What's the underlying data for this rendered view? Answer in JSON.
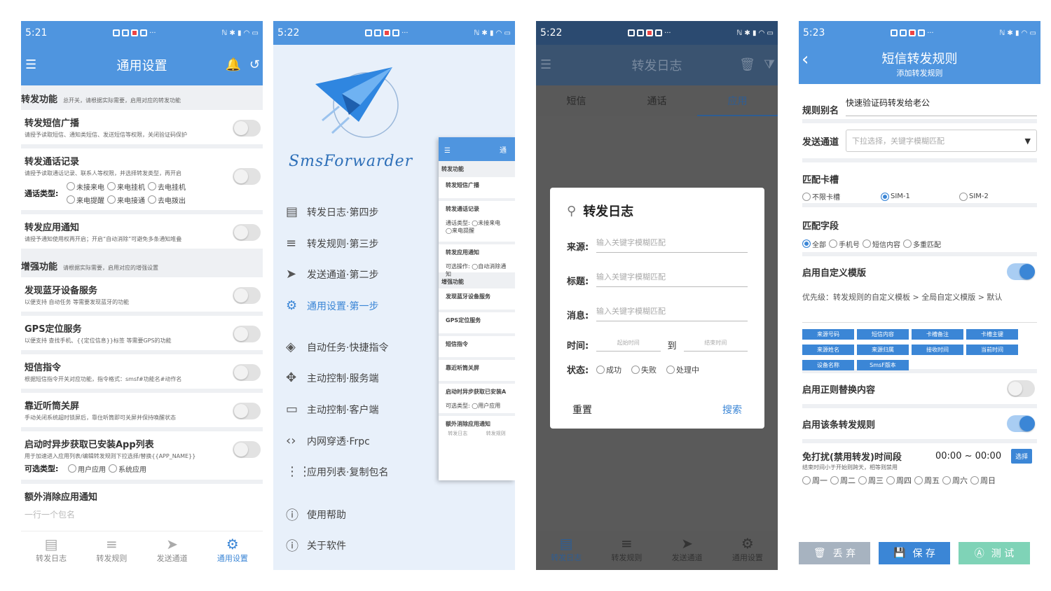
{
  "p1": {
    "time": "5:21",
    "title": "通用设置",
    "sec1": {
      "t": "转发功能",
      "d": "总开关，请根据实际需要，启用对应的转发功能"
    },
    "sms": {
      "t": "转发短信广播",
      "d": "请授予读取短信、通知类短信、发送短信等权限，关闭验证码保护"
    },
    "call": {
      "t": "转发通话记录",
      "d": "请授予读取通话记录、联系人等权限，并选择转发类型，再开启",
      "type_label": "通话类型:",
      "opts": [
        "未接来电",
        "来电挂机",
        "去电挂机",
        "来电提醒",
        "来电接通",
        "去电拨出"
      ]
    },
    "app": {
      "t": "转发应用通知",
      "d": "请授予通知使用权再开启；开启“自动消除”可避免多条通知堆叠"
    },
    "sec2": {
      "t": "增强功能",
      "d": "请根据实际需要，启用对应的增强设置"
    },
    "bt": {
      "t": "发现蓝牙设备服务",
      "d": "以便支持 自动任务 等需要发现蓝牙的功能"
    },
    "gps": {
      "t": "GPS定位服务",
      "d": "以便支持 查找手机、{{定位信息}}标签 等需要GPS的功能"
    },
    "cmd": {
      "t": "短信指令",
      "d": "根据短信指令开关对应功能，指令格式：smsf#功能名#动作名"
    },
    "close": {
      "t": "靠近听筒关屏",
      "d": "手动关闭系统超时锁屏后，靠住听筒即可关屏并保持唤醒状态"
    },
    "async": {
      "t": "启动时异步获取已安装App列表",
      "d": "用于加速进入应用列表/编辑转发规则下拉选择/替换{{APP_NAME}}",
      "type_label": "可选类型:",
      "opts": [
        "用户应用",
        "系统应用"
      ]
    },
    "extra": {
      "t": "额外消除应用通知",
      "d": "一行一个包名"
    },
    "nav": [
      "转发日志",
      "转发规则",
      "发送通道",
      "通用设置"
    ]
  },
  "p2": {
    "time": "5:22",
    "brand": "SmsForwarder",
    "menu": [
      "转发日志·第四步",
      "转发规则·第三步",
      "发送通道·第二步",
      "通用设置·第一步",
      "自动任务·快捷指令",
      "主动控制·服务端",
      "主动控制·客户端",
      "内网穿透·Frpc",
      "应用列表·复制包名",
      "使用帮助",
      "关于软件"
    ],
    "mini": {
      "title": "通",
      "sec1": "转发功能",
      "i1": "转发短信广播",
      "i2": "转发通话记录",
      "call_type": "通话类型:",
      "o1": "未接来电",
      "o2": "来电提醒",
      "i3": "转发应用通知",
      "ops": "可选操作:",
      "o3": "自动消除通知",
      "sec2": "增强功能",
      "i4": "发现蓝牙设备服务",
      "i5": "GPS定位服务",
      "i6": "短信指令",
      "i7": "靠近听筒关屏",
      "i8": "启动时异步获取已安装A",
      "opt_type": "可选类型:",
      "o4": "用户应用",
      "i9": "额外消除应用通知",
      "n1": "转发日志",
      "n2": "转发规则"
    }
  },
  "p3": {
    "time": "5:22",
    "title": "转发日志",
    "tabs": [
      "短信",
      "通话",
      "应用"
    ],
    "dialog": {
      "title": "转发日志",
      "from": "来源:",
      "subject": "标题:",
      "msg": "消息:",
      "ph": "输入关键字模糊匹配",
      "time": "时间:",
      "start": "起始时间",
      "to": "到",
      "end": "结束时间",
      "status": "状态:",
      "s": [
        "成功",
        "失败",
        "处理中"
      ],
      "reset": "重置",
      "search": "搜索"
    },
    "nav": [
      "转发日志",
      "转发规则",
      "发送通道",
      "通用设置"
    ]
  },
  "p4": {
    "time": "5:23",
    "title": "短信转发规则",
    "subtitle": "添加转发规则",
    "alias_l": "规则别名",
    "alias_v": "快速验证码转发给老公",
    "chan_l": "发送通道",
    "chan_ph": "下拉选择，关键字模糊匹配",
    "sim_l": "匹配卡槽",
    "sim": [
      "不限卡槽",
      "SIM-1",
      "SIM-2"
    ],
    "field_l": "匹配字段",
    "field": [
      "全部",
      "手机号",
      "短信内容",
      "多重匹配"
    ],
    "tpl_l": "启用自定义模版",
    "tpl_d": "优先级：转发规则的自定义模板 > 全局自定义模版 > 默认",
    "chips": [
      "来源号码",
      "短信内容",
      "卡槽备注",
      "卡槽主键",
      "来源姓名",
      "来源归属",
      "接收时间",
      "当前时间",
      "设备名称",
      "SmsF版本"
    ],
    "regex_l": "启用正则替换内容",
    "rule_l": "启用该条转发规则",
    "dnd_l": "免打扰(禁用转发)时间段",
    "dnd_v": "00:00 ~ 00:00",
    "dnd_btn": "选择",
    "dnd_d": "结束时间小于开始则跨天，相等则禁用",
    "days": [
      "周一",
      "周二",
      "周三",
      "周四",
      "周五",
      "周六",
      "周日"
    ],
    "b1": "丢 弃",
    "b2": "保 存",
    "b3": "测 试"
  }
}
